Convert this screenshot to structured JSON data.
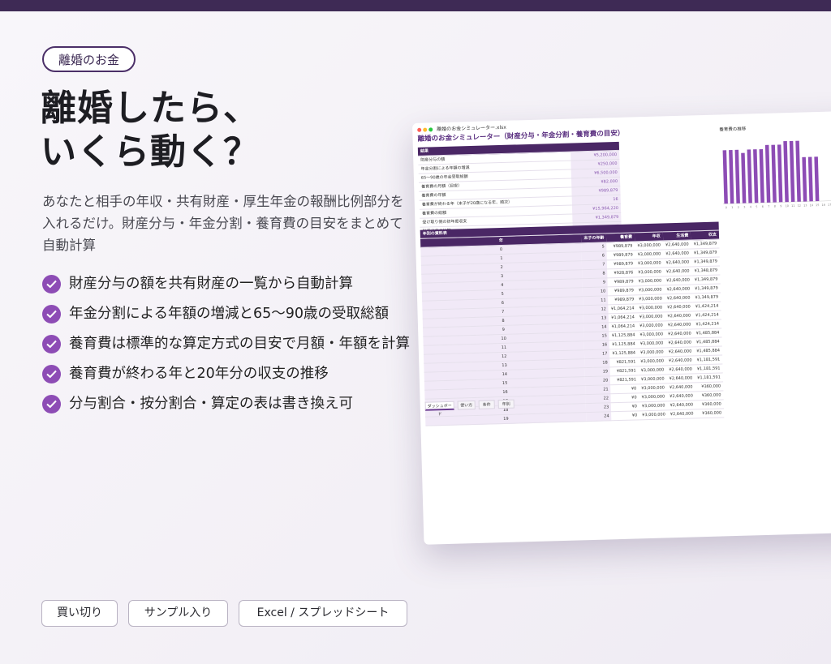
{
  "tag": "離婚のお金",
  "title": [
    "離婚したら、",
    "いくら動く？"
  ],
  "description": "あなたと相手の年収・共有財産・厚生年金の報酬比例部分を入れるだけ。財産分与・年金分割・養育費の目安をまとめて自動計算",
  "features": [
    "財産分与の額を共有財産の一覧から自動計算",
    "年金分割による年額の増減と65〜90歳の受取総額",
    "養育費は標準的な算定方式の目安で月額・年額を計算",
    "養育費が終わる年と20年分の収支の推移",
    "分与割合・按分割合・算定の表は書き換え可"
  ],
  "badges": [
    "買い切り",
    "サンプル入り",
    "Excel / スプレッドシート"
  ],
  "colors": {
    "accent": "#8d4cb5",
    "dark": "#3e2a55",
    "header": "#4a2765"
  },
  "spreadsheet": {
    "file_name": "離婚のお金シミュレーター.xlsx",
    "title": "離婚のお金シミュレーター（財産分与・年金分割・養育費の目安）",
    "summary_header": "結果",
    "summary_rows": [
      {
        "label": "財産分与の額",
        "value": "¥5,200,000"
      },
      {
        "label": "年金分割による年額の増減",
        "value": "¥250,000"
      },
      {
        "label": "65〜90歳の年金受取総額",
        "value": "¥6,500,000"
      },
      {
        "label": "養育費の月額（目安）",
        "value": "¥82,000"
      },
      {
        "label": "養育費の年額",
        "value": "¥989,879"
      },
      {
        "label": "養育費が終わる年（末子が20歳になる年、順次）",
        "value": "16"
      },
      {
        "label": "養育費の総額",
        "value": "¥15,964,220"
      },
      {
        "label": "受け取り側の初年度収支",
        "value": "¥1,349,879"
      },
      {
        "label": "財産分与の比較",
        "value": ""
      }
    ],
    "yearly_header": "年別の資料表",
    "yearly_columns": [
      "年",
      "末子の年齢",
      "養育費",
      "年収",
      "生活費",
      "収支"
    ],
    "yearly_rows": [
      [
        "0",
        "5",
        "¥989,879",
        "¥3,000,000",
        "¥2,640,000",
        "¥1,349,879"
      ],
      [
        "1",
        "6",
        "¥989,879",
        "¥3,000,000",
        "¥2,640,000",
        "¥1,349,879"
      ],
      [
        "2",
        "7",
        "¥989,879",
        "¥3,000,000",
        "¥2,640,000",
        "¥1,349,879"
      ],
      [
        "3",
        "8",
        "¥928,876",
        "¥3,000,000",
        "¥2,640,000",
        "¥1,348,879"
      ],
      [
        "4",
        "9",
        "¥989,879",
        "¥3,000,000",
        "¥2,640,000",
        "¥1,349,879"
      ],
      [
        "5",
        "10",
        "¥989,879",
        "¥3,000,000",
        "¥2,640,000",
        "¥1,349,879"
      ],
      [
        "6",
        "11",
        "¥989,879",
        "¥3,000,000",
        "¥2,640,000",
        "¥1,349,879"
      ],
      [
        "7",
        "12",
        "¥1,064,214",
        "¥3,000,000",
        "¥2,640,000",
        "¥1,424,214"
      ],
      [
        "8",
        "13",
        "¥1,064,214",
        "¥3,000,000",
        "¥2,640,000",
        "¥1,424,214"
      ],
      [
        "9",
        "14",
        "¥1,064,214",
        "¥3,000,000",
        "¥2,640,000",
        "¥1,424,214"
      ],
      [
        "10",
        "15",
        "¥1,125,884",
        "¥3,000,000",
        "¥2,640,000",
        "¥1,485,884"
      ],
      [
        "11",
        "16",
        "¥1,125,884",
        "¥3,000,000",
        "¥2,640,000",
        "¥1,485,884"
      ],
      [
        "12",
        "17",
        "¥1,125,884",
        "¥3,000,000",
        "¥2,640,000",
        "¥1,485,884"
      ],
      [
        "13",
        "18",
        "¥821,591",
        "¥3,000,000",
        "¥2,640,000",
        "¥1,181,591"
      ],
      [
        "14",
        "19",
        "¥821,591",
        "¥3,000,000",
        "¥2,640,000",
        "¥1,181,591"
      ],
      [
        "15",
        "20",
        "¥821,591",
        "¥3,000,000",
        "¥2,640,000",
        "¥1,181,591"
      ],
      [
        "16",
        "21",
        "¥0",
        "¥3,000,000",
        "¥2,640,000",
        "¥360,000"
      ],
      [
        "17",
        "22",
        "¥0",
        "¥3,000,000",
        "¥2,640,000",
        "¥360,000"
      ],
      [
        "18",
        "23",
        "¥0",
        "¥3,000,000",
        "¥2,640,000",
        "¥360,000"
      ],
      [
        "19",
        "24",
        "¥0",
        "¥3,000,000",
        "¥2,640,000",
        "¥360,000"
      ]
    ],
    "chart_title": "養育費の推移",
    "sheet_tabs": [
      "ダッシュボード",
      "使い方",
      "条件",
      "年別"
    ]
  },
  "chart_data": {
    "type": "bar",
    "title": "養育費の推移",
    "categories": [
      "0",
      "1",
      "2",
      "3",
      "4",
      "5",
      "6",
      "7",
      "8",
      "9",
      "10",
      "11",
      "12",
      "13",
      "14",
      "15",
      "16",
      "17",
      "18",
      "19"
    ],
    "values": [
      989879,
      989879,
      989879,
      928876,
      989879,
      989879,
      989879,
      1064214,
      1064214,
      1064214,
      1125884,
      1125884,
      1125884,
      821591,
      821591,
      821591,
      0,
      0,
      0,
      0
    ],
    "ylim": [
      0,
      1200000
    ],
    "color": "#8d4cb5"
  }
}
